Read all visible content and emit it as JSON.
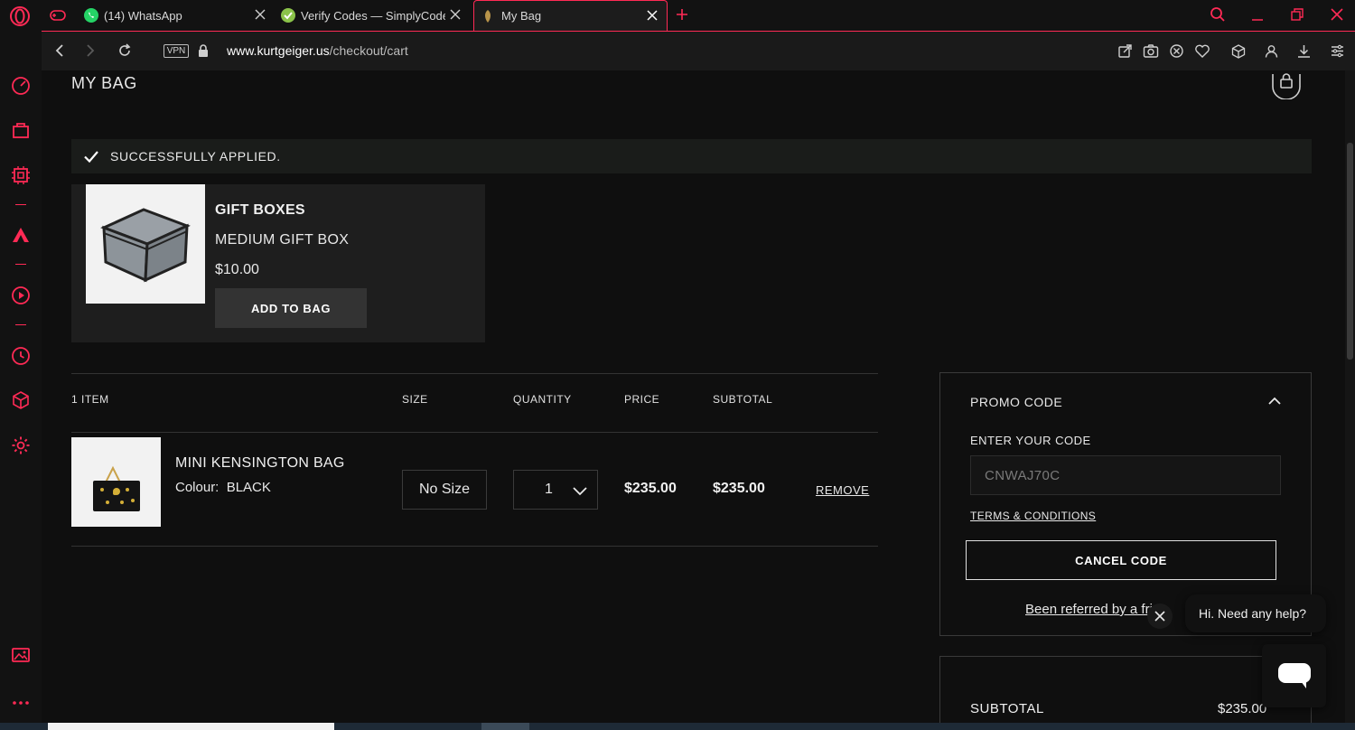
{
  "browser": {
    "tabs": [
      {
        "title": "(14) WhatsApp"
      },
      {
        "title": "Verify Codes — SimplyCodes"
      },
      {
        "title": "My Bag"
      }
    ],
    "url_domain": "www.kurtgeiger.us",
    "url_path": "/checkout/cart",
    "vpn_label": "VPN"
  },
  "page": {
    "title": "MY BAG",
    "notice": "SUCCESSFULLY APPLIED.",
    "gift": {
      "category": "GIFT BOXES",
      "name": "MEDIUM GIFT BOX",
      "price": "$10.00",
      "add_label": "ADD TO BAG"
    },
    "cart_headers": {
      "items": "1 ITEM",
      "size": "SIZE",
      "quantity": "QUANTITY",
      "price": "PRICE",
      "subtotal": "SUBTOTAL"
    },
    "cart_item": {
      "name": "MINI KENSINGTON BAG",
      "colour_label": "Colour:",
      "colour_value": "BLACK",
      "size": "No Size",
      "quantity": "1",
      "price": "$235.00",
      "subtotal": "$235.00",
      "remove_label": "REMOVE"
    },
    "promo": {
      "title": "PROMO CODE",
      "enter_label": "ENTER YOUR CODE",
      "code": "CNWAJ70C",
      "terms_label": "TERMS & CONDITIONS",
      "cancel_label": "CANCEL CODE",
      "referred_label": "Been referred by a fri"
    },
    "summary": {
      "subtotal_label": "SUBTOTAL",
      "subtotal_value": "$235.00"
    },
    "chat": {
      "bubble": "Hi. Need any help?"
    }
  },
  "colors": {
    "accent": "#ff2a55",
    "notice_bg": "#1a1c1a",
    "panel_bg": "#1e1e1e"
  }
}
